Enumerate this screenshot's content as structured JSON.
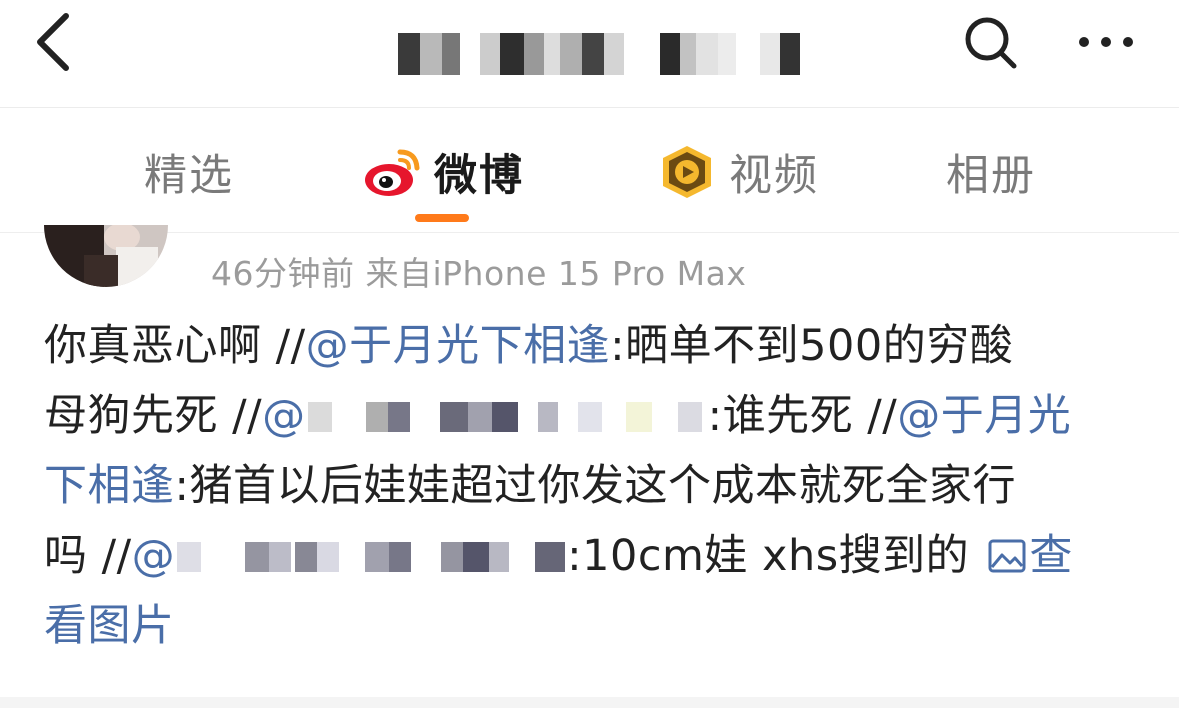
{
  "header": {
    "title": "",
    "back_icon": "chevron-left-icon",
    "search_icon": "search-icon",
    "more_icon": "more-horizontal-icon"
  },
  "tabs": [
    {
      "label": "精选",
      "icon": null,
      "active": false
    },
    {
      "label": "微博",
      "icon": "weibo-logo-icon",
      "active": true
    },
    {
      "label": "视频",
      "icon": "video-play-icon",
      "active": false
    },
    {
      "label": "相册",
      "icon": null,
      "active": false
    }
  ],
  "post": {
    "meta": "46分钟前  来自iPhone 15 Pro Max",
    "lines": {
      "l1_a": "你真恶心啊 //",
      "l1_mention": "@于月光下相逢",
      "l1_b": ":晒单不到500的穷酸",
      "l2_a": "母狗先死 //",
      "l2_mention": "@",
      "l2_b": ":谁先死 //",
      "l2_mention2": "@于月光",
      "l3_mention": "下相逢",
      "l3_b": ":猪首以后娃娃超过你发这个成本就死全家行",
      "l4_a": "吗 //",
      "l4_mention": "@",
      "l4_b": ":10cm娃 xhs搜到的 ",
      "l4_link": "查",
      "l5_link": "看图片"
    }
  },
  "colors": {
    "accent": "#ff7a1a",
    "mention": "#4a6ea8",
    "meta": "#9b9b9b",
    "text": "#222222"
  }
}
